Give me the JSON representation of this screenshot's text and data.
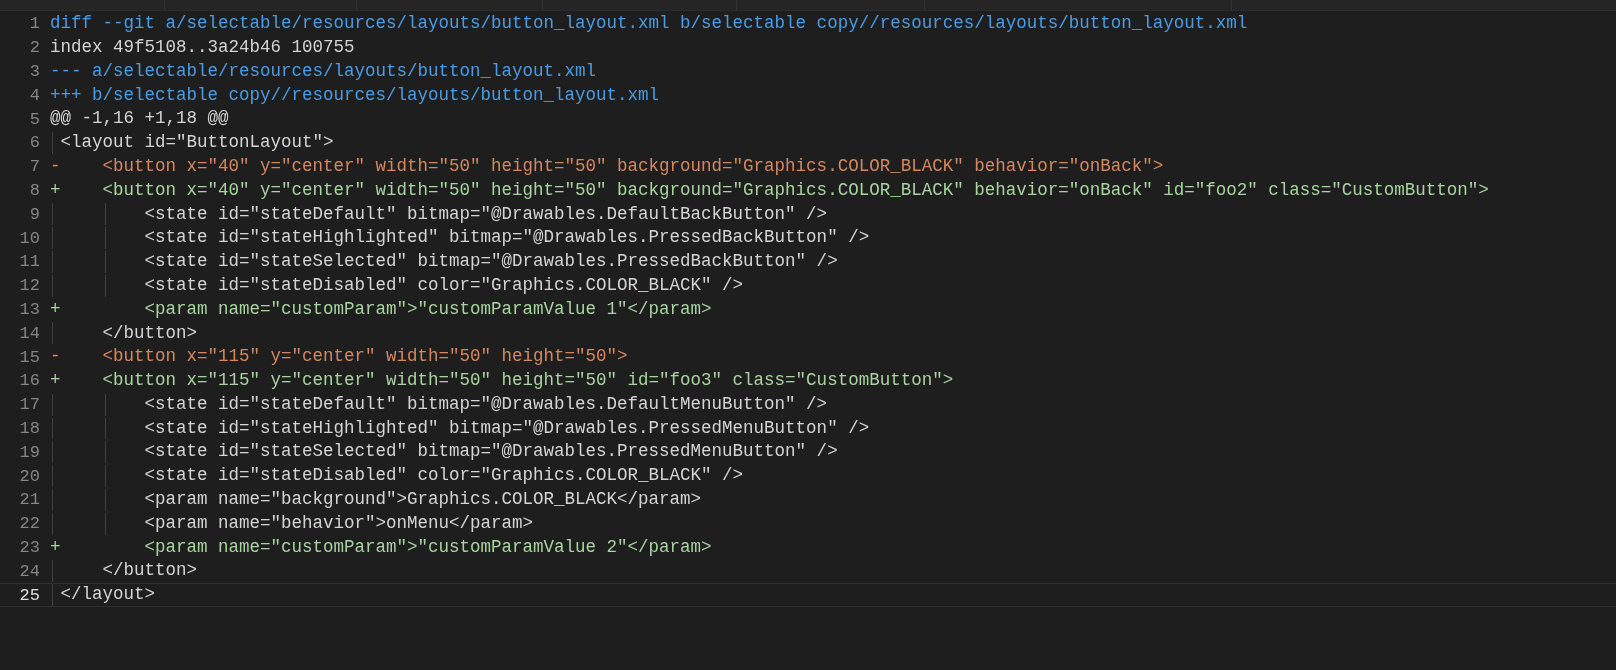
{
  "editor": {
    "lines": [
      {
        "number": "1",
        "kind": "meta",
        "current": false,
        "text": "diff --git a/selectable/resources/layouts/button_layout.xml b/selectable copy//resources/layouts/button_layout.xml"
      },
      {
        "number": "2",
        "kind": "plain",
        "current": false,
        "text": "index 49f5108..3a24b46 100755"
      },
      {
        "number": "3",
        "kind": "meta",
        "current": false,
        "text": "--- a/selectable/resources/layouts/button_layout.xml"
      },
      {
        "number": "4",
        "kind": "meta",
        "current": false,
        "text": "+++ b/selectable copy//resources/layouts/button_layout.xml"
      },
      {
        "number": "5",
        "kind": "plain",
        "current": false,
        "text": "@@ -1,16 +1,18 @@"
      },
      {
        "number": "6",
        "kind": "plain",
        "current": false,
        "text": " <layout id=\"ButtonLayout\">"
      },
      {
        "number": "7",
        "kind": "removed",
        "current": false,
        "text": "-    <button x=\"40\" y=\"center\" width=\"50\" height=\"50\" background=\"Graphics.COLOR_BLACK\" behavior=\"onBack\">"
      },
      {
        "number": "8",
        "kind": "added",
        "current": false,
        "text": "+    <button x=\"40\" y=\"center\" width=\"50\" height=\"50\" background=\"Graphics.COLOR_BLACK\" behavior=\"onBack\" id=\"foo2\" class=\"CustomButton\">"
      },
      {
        "number": "9",
        "kind": "plain",
        "current": false,
        "text": "         <state id=\"stateDefault\" bitmap=\"@Drawables.DefaultBackButton\" />"
      },
      {
        "number": "10",
        "kind": "plain",
        "current": false,
        "text": "         <state id=\"stateHighlighted\" bitmap=\"@Drawables.PressedBackButton\" />"
      },
      {
        "number": "11",
        "kind": "plain",
        "current": false,
        "text": "         <state id=\"stateSelected\" bitmap=\"@Drawables.PressedBackButton\" />"
      },
      {
        "number": "12",
        "kind": "plain",
        "current": false,
        "text": "         <state id=\"stateDisabled\" color=\"Graphics.COLOR_BLACK\" />"
      },
      {
        "number": "13",
        "kind": "added",
        "current": false,
        "text": "+        <param name=\"customParam\">\"customParamValue 1\"</param>"
      },
      {
        "number": "14",
        "kind": "plain",
        "current": false,
        "text": "     </button>"
      },
      {
        "number": "15",
        "kind": "removed",
        "current": false,
        "text": "-    <button x=\"115\" y=\"center\" width=\"50\" height=\"50\">"
      },
      {
        "number": "16",
        "kind": "added",
        "current": false,
        "text": "+    <button x=\"115\" y=\"center\" width=\"50\" height=\"50\" id=\"foo3\" class=\"CustomButton\">"
      },
      {
        "number": "17",
        "kind": "plain",
        "current": false,
        "text": "         <state id=\"stateDefault\" bitmap=\"@Drawables.DefaultMenuButton\" />"
      },
      {
        "number": "18",
        "kind": "plain",
        "current": false,
        "text": "         <state id=\"stateHighlighted\" bitmap=\"@Drawables.PressedMenuButton\" />"
      },
      {
        "number": "19",
        "kind": "plain",
        "current": false,
        "text": "         <state id=\"stateSelected\" bitmap=\"@Drawables.PressedMenuButton\" />"
      },
      {
        "number": "20",
        "kind": "plain",
        "current": false,
        "text": "         <state id=\"stateDisabled\" color=\"Graphics.COLOR_BLACK\" />"
      },
      {
        "number": "21",
        "kind": "plain",
        "current": false,
        "text": "         <param name=\"background\">Graphics.COLOR_BLACK</param>"
      },
      {
        "number": "22",
        "kind": "plain",
        "current": false,
        "text": "         <param name=\"behavior\">onMenu</param>"
      },
      {
        "number": "23",
        "kind": "added",
        "current": false,
        "text": "+        <param name=\"customParam\">\"customParamValue 2\"</param>"
      },
      {
        "number": "24",
        "kind": "plain",
        "current": false,
        "text": "     </button>"
      },
      {
        "number": "25",
        "kind": "plain",
        "current": true,
        "text": " </layout>"
      }
    ]
  }
}
